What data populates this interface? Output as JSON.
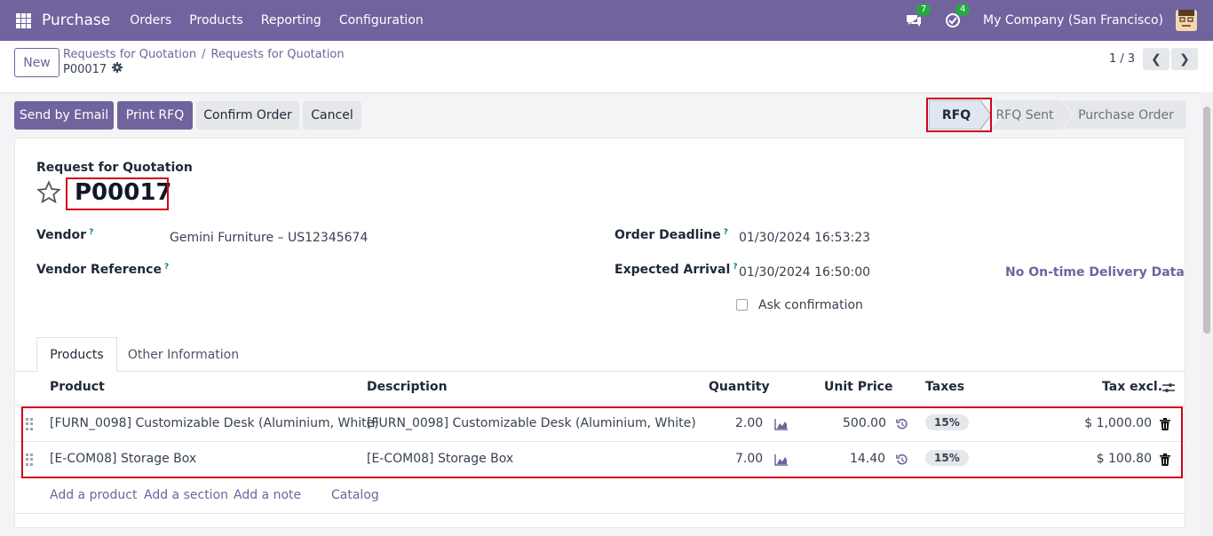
{
  "nav": {
    "app_title": "Purchase",
    "menus": [
      "Orders",
      "Products",
      "Reporting",
      "Configuration"
    ],
    "messages_count": "7",
    "activities_count": "4",
    "company": "My Company (San Francisco)"
  },
  "control": {
    "new_label": "New",
    "breadcrumb_parent": "Requests for Quotation",
    "breadcrumb_sep": "/",
    "breadcrumb_current": "Requests for Quotation",
    "record_name": "P00017",
    "pager": "1 / 3"
  },
  "actions": {
    "send_email": "Send by Email",
    "print_rfq": "Print RFQ",
    "confirm_order": "Confirm Order",
    "cancel": "Cancel"
  },
  "statusbar": [
    "RFQ",
    "RFQ Sent",
    "Purchase Order"
  ],
  "form": {
    "title_label": "Request for Quotation",
    "reference": "P00017",
    "vendor_label": "Vendor",
    "vendor_value": "Gemini Furniture – US12345674",
    "vendor_ref_label": "Vendor Reference",
    "deadline_label": "Order Deadline",
    "deadline_value": "01/30/2024 16:53:23",
    "arrival_label": "Expected Arrival",
    "arrival_value": "01/30/2024 16:50:00",
    "delivery_data": "No On-time Delivery Data",
    "ask_confirmation": "Ask confirmation",
    "help_mark": "?"
  },
  "tabs": [
    "Products",
    "Other Information"
  ],
  "table": {
    "headers": {
      "product": "Product",
      "description": "Description",
      "quantity": "Quantity",
      "unit_price": "Unit Price",
      "taxes": "Taxes",
      "tax_excl": "Tax excl."
    },
    "rows": [
      {
        "product": "[FURN_0098] Customizable Desk (Aluminium, White)",
        "description": "[FURN_0098] Customizable Desk (Aluminium, White)",
        "quantity": "2.00",
        "unit_price": "500.00",
        "tax": "15%",
        "subtotal": "$ 1,000.00"
      },
      {
        "product": "[E-COM08] Storage Box",
        "description": "[E-COM08] Storage Box",
        "quantity": "7.00",
        "unit_price": "14.40",
        "tax": "15%",
        "subtotal": "$ 100.80"
      }
    ],
    "add_links": [
      "Add a product",
      "Add a section",
      "Add a note",
      "Catalog"
    ]
  },
  "colors": {
    "brand": "#71639e",
    "highlight": "#d0021b"
  }
}
